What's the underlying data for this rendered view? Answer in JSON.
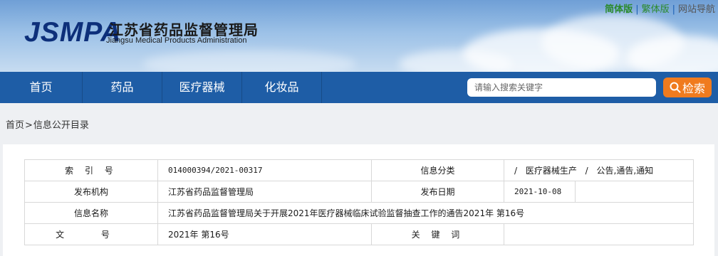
{
  "header": {
    "logo": "JSMPA",
    "org_cn": "江苏省药品监督管理局",
    "org_en": "Jiangsu Medical Products Administration"
  },
  "top_links": {
    "simplified": "简体版",
    "separator": "|",
    "traditional": "繁体版",
    "sitemap": "网站导航"
  },
  "nav": {
    "items": [
      {
        "label": "首页"
      },
      {
        "label": "药品"
      },
      {
        "label": "医疗器械"
      },
      {
        "label": "化妆品"
      }
    ]
  },
  "search": {
    "placeholder": "请输入搜索关键字",
    "button_label": "检索"
  },
  "breadcrumb": {
    "home": "首页",
    "arrow": ">",
    "current": "信息公开目录"
  },
  "info": {
    "index_label": "索 引 号",
    "index_value": "014000394/2021-00317",
    "category_label": "信息分类",
    "category_value": "/ 医疗器械生产 / 公告,通告,通知",
    "publisher_label": "发布机构",
    "publisher_value": "江苏省药品监督管理局",
    "date_label": "发布日期",
    "date_value": "2021-10-08",
    "name_label": "信息名称",
    "name_value": "江苏省药品监督管理局关于开展2021年医疗器械临床试验监督抽查工作的通告2021年 第16号",
    "docno_label": "文 号",
    "docno_value": "2021年 第16号",
    "keyword_label": "关 键 词",
    "keyword_value": ""
  },
  "colors": {
    "nav_bg": "#1e5da6",
    "search_button": "#f07b1e",
    "logo": "#0d2f7a",
    "top_link_green": "#2b8a2b"
  }
}
